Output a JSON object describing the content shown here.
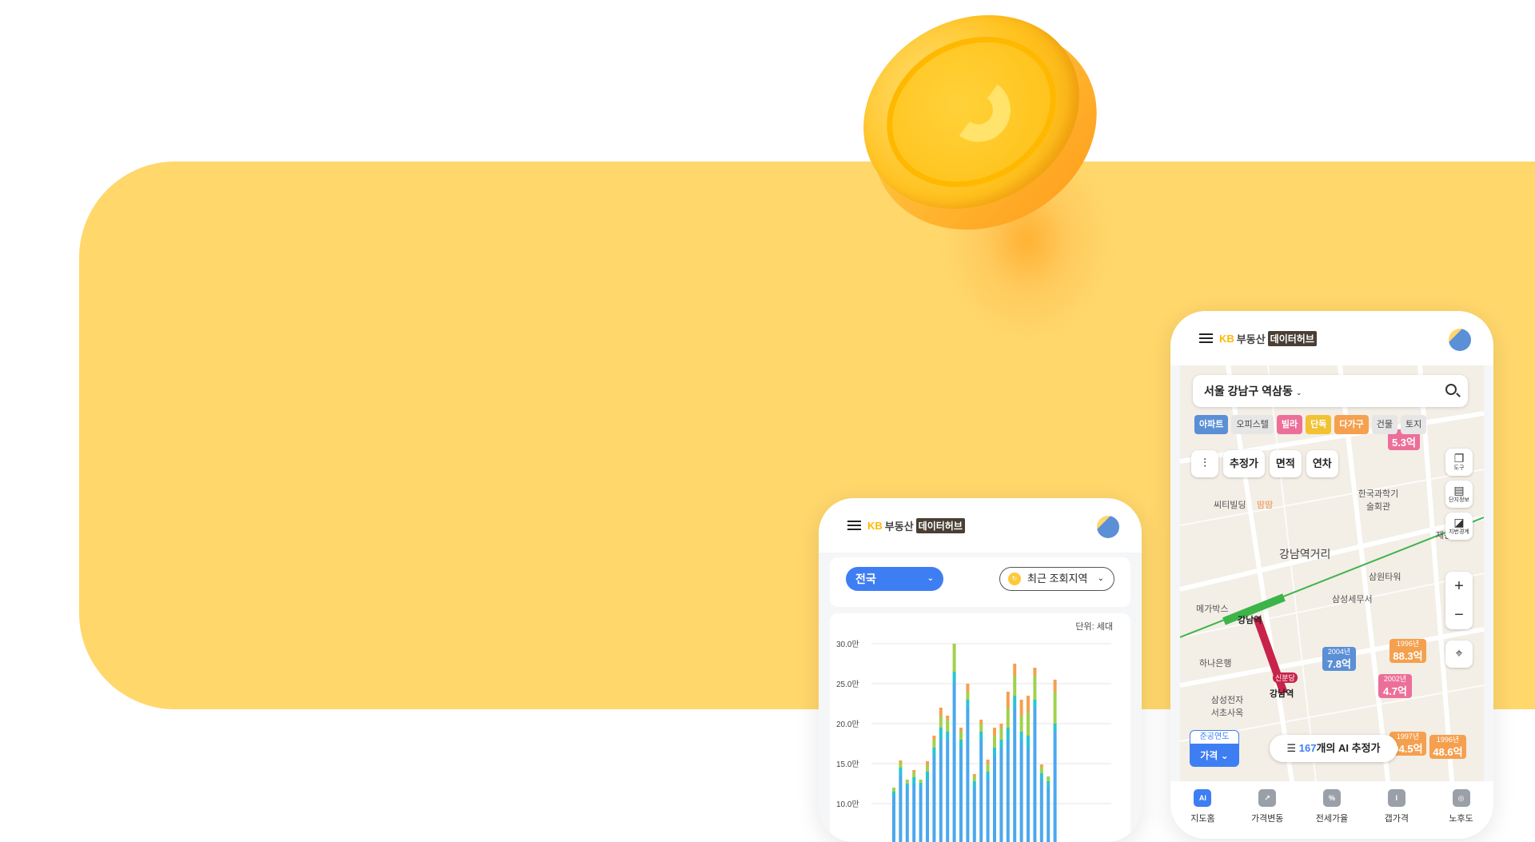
{
  "colors": {
    "banner": "#ffd76b",
    "primary_blue": "#3e7ef3",
    "apt_blue": "#5b8fd6",
    "pink": "#ec6f9a",
    "orange": "#f5a04f",
    "yellow": "#f2c233",
    "gray_chip": "#e6e6e6"
  },
  "brand": {
    "kb": "KB",
    "realestate": "부동산",
    "hub": "데이터허브"
  },
  "phone1": {
    "region_select": "전국",
    "recent_button": "최근 조회지역",
    "recent_icon": "refresh-icon",
    "unit_label": "단위: 세대"
  },
  "chart_data": {
    "type": "bar",
    "stacked": true,
    "ylabel": "",
    "y_ticks": [
      "30.0만",
      "25.0만",
      "20.0만",
      "15.0만",
      "10.0만"
    ],
    "ylim": [
      5,
      30
    ],
    "grid": true,
    "series": [
      {
        "color": "#4aa8ee",
        "values": [
          6,
          8.5,
          7,
          7.5,
          7,
          8,
          11,
          13,
          13,
          20,
          12,
          17,
          7,
          13,
          8,
          11,
          12,
          13,
          17,
          13,
          12,
          17,
          8,
          7,
          14
        ]
      },
      {
        "color": "#2bc4d4",
        "values": [
          0.5,
          1,
          0.5,
          0.8,
          0.6,
          1,
          1,
          1.5,
          1,
          1.5,
          1,
          1,
          0.8,
          1,
          1,
          1,
          1,
          1.5,
          1.5,
          1,
          1.5,
          1,
          0.8,
          0.8,
          1
        ]
      },
      {
        "color": "#a2d14c",
        "values": [
          0.5,
          0.6,
          0.5,
          0.6,
          0.4,
          0.8,
          1,
          1.5,
          1.5,
          3.5,
          1,
          1,
          0.6,
          1,
          1,
          1.5,
          1.5,
          2.5,
          2.5,
          2,
          3,
          3,
          0.8,
          0.6,
          4
        ]
      },
      {
        "color": "#f5a04f",
        "values": [
          0,
          0.3,
          0,
          0.3,
          0,
          0.5,
          0.5,
          1,
          0.5,
          0,
          0.5,
          1,
          0.3,
          0.5,
          0.5,
          1,
          0.5,
          2,
          1.5,
          2,
          2,
          1,
          0.3,
          0,
          1.5
        ]
      }
    ]
  },
  "phone2": {
    "search_text": "서울 강남구 역삼동",
    "chips": [
      {
        "label": "아파트",
        "color": "#5b8fd6"
      },
      {
        "label": "오피스텔",
        "color": "#e6e6e6"
      },
      {
        "label": "빌라",
        "color": "#ec6f9a"
      },
      {
        "label": "단독",
        "color": "#f2c233"
      },
      {
        "label": "다가구",
        "color": "#f5a04f"
      },
      {
        "label": "건물",
        "color": "#e6e6e6"
      },
      {
        "label": "토지",
        "color": "#e6e6e6"
      }
    ],
    "tools": [
      "추정가",
      "면적",
      "연차"
    ],
    "side_tools": [
      "도구",
      "단지정보",
      "지번경계"
    ],
    "map_labels": [
      "강남역거리",
      "씨티빌딩",
      "땀땀",
      "한국과학기술회관",
      "메가박스",
      "삼성세무서",
      "삼원타워",
      "하나은행",
      "삼성전자 서초사옥",
      "강남역",
      "신분당",
      "재산센터"
    ],
    "markers": [
      {
        "year": "2004년",
        "price": "7.8억",
        "color": "blue"
      },
      {
        "year": "1996년",
        "price": "88.3억",
        "color": "orange"
      },
      {
        "year": "2002년",
        "price": "4.7억",
        "color": "pink"
      },
      {
        "year": "1997년",
        "price": "94.5억",
        "color": "orange"
      },
      {
        "year": "1996년",
        "price": "48.6억",
        "color": "orange"
      },
      {
        "year": "",
        "price": "5.3억",
        "color": "pink"
      }
    ],
    "price_filter_top": "준공연도",
    "price_filter_bottom": "가격",
    "ai_count_num": "167",
    "ai_count_text": "개의 AI 추정가",
    "nav": [
      {
        "label": "지도홈",
        "icon": "ai-map-icon",
        "glyph": "AI"
      },
      {
        "label": "가격변동",
        "icon": "trend-chart-icon",
        "glyph": "↗"
      },
      {
        "label": "전세가율",
        "icon": "house-percent-icon",
        "glyph": "%"
      },
      {
        "label": "갭가격",
        "icon": "gap-icon",
        "glyph": "I"
      },
      {
        "label": "노후도",
        "icon": "map-pin-icon",
        "glyph": "◎"
      }
    ]
  }
}
